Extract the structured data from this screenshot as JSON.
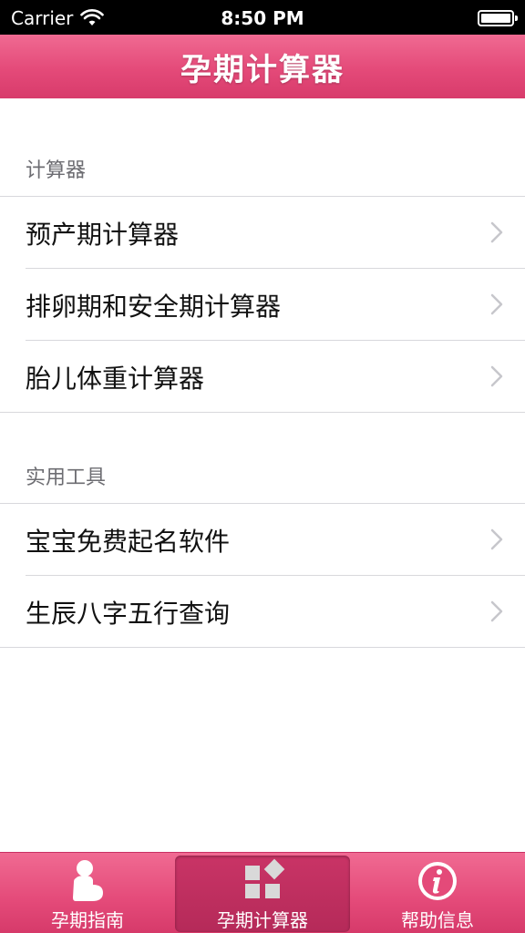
{
  "status_bar": {
    "carrier": "Carrier",
    "time": "8:50 PM"
  },
  "nav_bar": {
    "title": "孕期计算器"
  },
  "sections": [
    {
      "header": "计算器",
      "items": [
        {
          "label": "预产期计算器",
          "icon": "chevron-right-icon"
        },
        {
          "label": "排卵期和安全期计算器",
          "icon": "chevron-right-icon"
        },
        {
          "label": "胎儿体重计算器",
          "icon": "chevron-right-icon"
        }
      ]
    },
    {
      "header": "实用工具",
      "items": [
        {
          "label": "宝宝免费起名软件",
          "icon": "chevron-right-icon"
        },
        {
          "label": "生辰八字五行查询",
          "icon": "chevron-right-icon"
        }
      ]
    }
  ],
  "tab_bar": {
    "tabs": [
      {
        "label": "孕期指南",
        "icon": "pregnant-woman-icon",
        "selected": false
      },
      {
        "label": "孕期计算器",
        "icon": "blocks-icon",
        "selected": true
      },
      {
        "label": "帮助信息",
        "icon": "info-icon",
        "selected": false
      }
    ]
  },
  "colors": {
    "accent": "#e44a79",
    "accent_dark": "#b52a59",
    "section_text": "#6d6d72"
  }
}
